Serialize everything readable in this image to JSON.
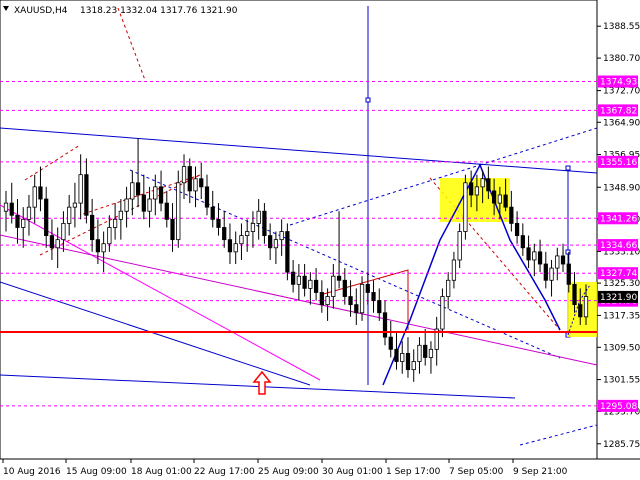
{
  "header": {
    "symbol": "XAUUSD,H4",
    "ohlc": "1318.23 1332.04 1317.76 1321.90"
  },
  "colors": {
    "bull_candle": "#ffffff",
    "bear_candle": "#000000",
    "level_line": "#ff00ff",
    "support_line": "#ff0000",
    "trend_line": "#0000cc",
    "forecast_box": "#ffff00",
    "price_label": "#ff00ff",
    "current_price_label": "#000000",
    "arrow": "#ff0000"
  },
  "chart_data": {
    "type": "candlestick",
    "title": "XAUUSD,H4",
    "ylim": [
      1282.0,
      1395.0
    ],
    "y_ticks": [
      "1388.55",
      "1380.70",
      "1372.70",
      "1364.90",
      "1356.95",
      "1348.90",
      "1341.10",
      "1333.10",
      "1325.30",
      "1317.35",
      "1309.50",
      "1301.55",
      "1293.70",
      "1285.75"
    ],
    "x_ticks": [
      "10 Aug 2016",
      "15 Aug 09:00",
      "18 Aug 01:00",
      "22 Aug 17:00",
      "25 Aug 09:00",
      "30 Aug 01:00",
      "1 Sep 17:00",
      "7 Sep 05:00",
      "9 Sep 21:00"
    ],
    "levels": [
      {
        "value": 1374.93,
        "label": "1374.93"
      },
      {
        "value": 1367.82,
        "label": "1367.82"
      },
      {
        "value": 1355.16,
        "label": "1355.16"
      },
      {
        "value": 1341.26,
        "label": "1341.26"
      },
      {
        "value": 1334.66,
        "label": "1334.66"
      },
      {
        "value": 1327.74,
        "label": "1327.74"
      },
      {
        "value": 1320.98,
        "label": "1320.98"
      },
      {
        "value": 1295.08,
        "label": "1295.08"
      }
    ],
    "current_price": {
      "value": 1321.9,
      "label": "1321.90"
    },
    "support_level": 1314.0,
    "candles": [
      [
        1343,
        1348,
        1338,
        1345
      ],
      [
        1345,
        1350,
        1340,
        1342
      ],
      [
        1342,
        1346,
        1335,
        1339
      ],
      [
        1339,
        1344,
        1334,
        1341
      ],
      [
        1341,
        1347,
        1337,
        1344
      ],
      [
        1344,
        1352,
        1340,
        1349
      ],
      [
        1349,
        1354,
        1343,
        1346
      ],
      [
        1346,
        1349,
        1334,
        1337
      ],
      [
        1337,
        1341,
        1331,
        1334
      ],
      [
        1334,
        1339,
        1329,
        1336
      ],
      [
        1336,
        1343,
        1333,
        1340
      ],
      [
        1340,
        1347,
        1337,
        1344
      ],
      [
        1344,
        1350,
        1339,
        1345
      ],
      [
        1345,
        1357,
        1341,
        1352
      ],
      [
        1352,
        1356,
        1340,
        1342
      ],
      [
        1342,
        1346,
        1333,
        1336
      ],
      [
        1336,
        1341,
        1330,
        1333
      ],
      [
        1333,
        1338,
        1328,
        1335
      ],
      [
        1335,
        1342,
        1333,
        1339
      ],
      [
        1339,
        1345,
        1336,
        1341
      ],
      [
        1341,
        1346,
        1336,
        1343
      ],
      [
        1343,
        1349,
        1339,
        1346
      ],
      [
        1346,
        1353,
        1342,
        1350
      ],
      [
        1350,
        1361,
        1344,
        1347
      ],
      [
        1347,
        1352,
        1341,
        1343
      ],
      [
        1343,
        1349,
        1339,
        1346
      ],
      [
        1346,
        1352,
        1342,
        1349
      ],
      [
        1349,
        1353,
        1343,
        1345
      ],
      [
        1345,
        1348,
        1339,
        1341
      ],
      [
        1341,
        1345,
        1333,
        1336
      ],
      [
        1336,
        1353,
        1334,
        1350
      ],
      [
        1350,
        1357,
        1346,
        1354
      ],
      [
        1354,
        1356,
        1345,
        1348
      ],
      [
        1348,
        1354,
        1344,
        1351
      ],
      [
        1351,
        1355,
        1346,
        1349
      ],
      [
        1349,
        1352,
        1342,
        1344
      ],
      [
        1344,
        1348,
        1339,
        1341
      ],
      [
        1341,
        1345,
        1337,
        1339
      ],
      [
        1339,
        1343,
        1334,
        1336
      ],
      [
        1336,
        1340,
        1330,
        1333
      ],
      [
        1333,
        1338,
        1330,
        1335
      ],
      [
        1335,
        1340,
        1331,
        1337
      ],
      [
        1337,
        1341,
        1333,
        1338
      ],
      [
        1338,
        1343,
        1334,
        1340
      ],
      [
        1340,
        1346,
        1336,
        1343
      ],
      [
        1343,
        1345,
        1335,
        1337
      ],
      [
        1337,
        1340,
        1331,
        1334
      ],
      [
        1334,
        1338,
        1330,
        1336
      ],
      [
        1336,
        1341,
        1332,
        1338
      ],
      [
        1338,
        1340,
        1326,
        1328
      ],
      [
        1328,
        1331,
        1323,
        1325
      ],
      [
        1325,
        1330,
        1321,
        1327
      ],
      [
        1327,
        1330,
        1322,
        1324
      ],
      [
        1324,
        1328,
        1320,
        1326
      ],
      [
        1326,
        1329,
        1321,
        1323
      ],
      [
        1323,
        1326,
        1318,
        1320
      ],
      [
        1320,
        1324,
        1316,
        1322
      ],
      [
        1322,
        1330,
        1319,
        1327
      ],
      [
        1327,
        1343,
        1324,
        1326
      ],
      [
        1326,
        1329,
        1320,
        1322
      ],
      [
        1322,
        1326,
        1317,
        1320
      ],
      [
        1320,
        1324,
        1315,
        1318
      ],
      [
        1318,
        1327,
        1316,
        1325
      ],
      [
        1325,
        1328,
        1320,
        1323
      ],
      [
        1323,
        1326,
        1318,
        1321
      ],
      [
        1321,
        1324,
        1316,
        1318
      ],
      [
        1318,
        1321,
        1310,
        1312
      ],
      [
        1312,
        1316,
        1307,
        1309
      ],
      [
        1309,
        1313,
        1304,
        1306
      ],
      [
        1306,
        1311,
        1303,
        1308
      ],
      [
        1308,
        1312,
        1302,
        1304
      ],
      [
        1304,
        1309,
        1301,
        1306
      ],
      [
        1306,
        1312,
        1303,
        1310
      ],
      [
        1310,
        1314,
        1305,
        1307
      ],
      [
        1307,
        1311,
        1303,
        1309
      ],
      [
        1309,
        1317,
        1305,
        1314
      ],
      [
        1314,
        1324,
        1312,
        1322
      ],
      [
        1322,
        1328,
        1319,
        1326
      ],
      [
        1326,
        1333,
        1324,
        1331
      ],
      [
        1331,
        1340,
        1329,
        1338
      ],
      [
        1338,
        1352,
        1336,
        1350
      ],
      [
        1350,
        1353,
        1344,
        1347
      ],
      [
        1347,
        1352,
        1343,
        1349
      ],
      [
        1349,
        1353,
        1345,
        1351
      ],
      [
        1351,
        1354,
        1346,
        1348
      ],
      [
        1348,
        1351,
        1342,
        1345
      ],
      [
        1345,
        1349,
        1341,
        1347
      ],
      [
        1347,
        1351,
        1343,
        1344
      ],
      [
        1344,
        1348,
        1338,
        1340
      ],
      [
        1340,
        1343,
        1335,
        1337
      ],
      [
        1337,
        1340,
        1332,
        1334
      ],
      [
        1334,
        1337,
        1329,
        1331
      ],
      [
        1331,
        1335,
        1327,
        1333
      ],
      [
        1333,
        1336,
        1328,
        1330
      ],
      [
        1330,
        1333,
        1324,
        1326
      ],
      [
        1326,
        1331,
        1322,
        1329
      ],
      [
        1329,
        1334,
        1326,
        1332
      ],
      [
        1332,
        1335,
        1328,
        1330
      ],
      [
        1330,
        1333,
        1323,
        1325
      ],
      [
        1325,
        1328,
        1318,
        1320
      ],
      [
        1320,
        1324,
        1315,
        1317
      ],
      [
        1317,
        1325,
        1315,
        1322
      ]
    ],
    "annotations": [
      "forecast_box_top",
      "forecast_box_right",
      "up_arrow"
    ]
  }
}
